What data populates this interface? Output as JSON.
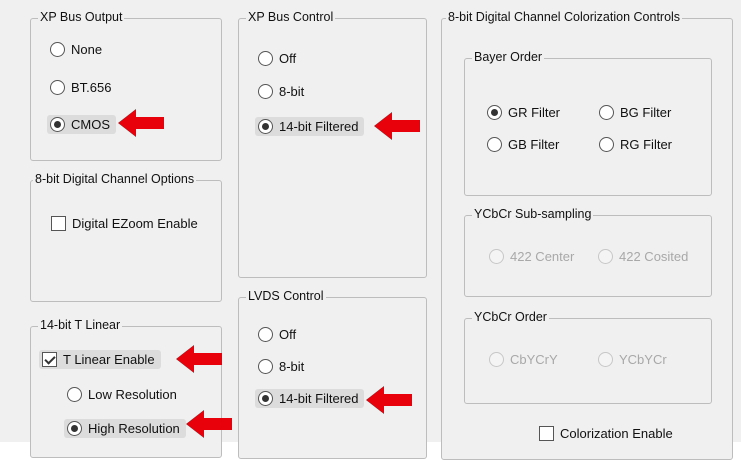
{
  "xp_bus_output": {
    "title": "XP Bus Output",
    "options": [
      "None",
      "BT.656",
      "CMOS"
    ],
    "selected": "CMOS"
  },
  "digital_channel_options": {
    "title": "8-bit Digital Channel Options",
    "ezoom_label": "Digital EZoom Enable",
    "ezoom_checked": false
  },
  "t_linear": {
    "title": "14-bit T Linear",
    "enable_label": "T Linear Enable",
    "enable_checked": true,
    "options": [
      "Low Resolution",
      "High Resolution"
    ],
    "selected": "High Resolution"
  },
  "xp_bus_control": {
    "title": "XP Bus Control",
    "options": [
      "Off",
      "8-bit",
      "14-bit Filtered"
    ],
    "selected": "14-bit Filtered"
  },
  "lvds_control": {
    "title": "LVDS Control",
    "options": [
      "Off",
      "8-bit",
      "14-bit Filtered"
    ],
    "selected": "14-bit Filtered"
  },
  "colorization": {
    "title": "8-bit Digital Channel Colorization Controls",
    "bayer_order": {
      "title": "Bayer Order",
      "options": [
        "GR Filter",
        "BG Filter",
        "GB Filter",
        "RG Filter"
      ],
      "selected": "GR Filter"
    },
    "ycbcr_subsampling": {
      "title": "YCbCr Sub-sampling",
      "options": [
        "422 Center",
        "422 Cosited"
      ]
    },
    "ycbcr_order": {
      "title": "YCbCr Order",
      "options": [
        "CbYCrY",
        "YCbYCr"
      ]
    },
    "enable_label": "Colorization Enable",
    "enable_checked": false
  },
  "colors": {
    "panel_bg": "#f0f0f0",
    "group_border": "#bdbdbd",
    "arrow_red": "#e8000b",
    "highlight": "#dcdcdc",
    "disabled_text": "#a8a8a8"
  }
}
